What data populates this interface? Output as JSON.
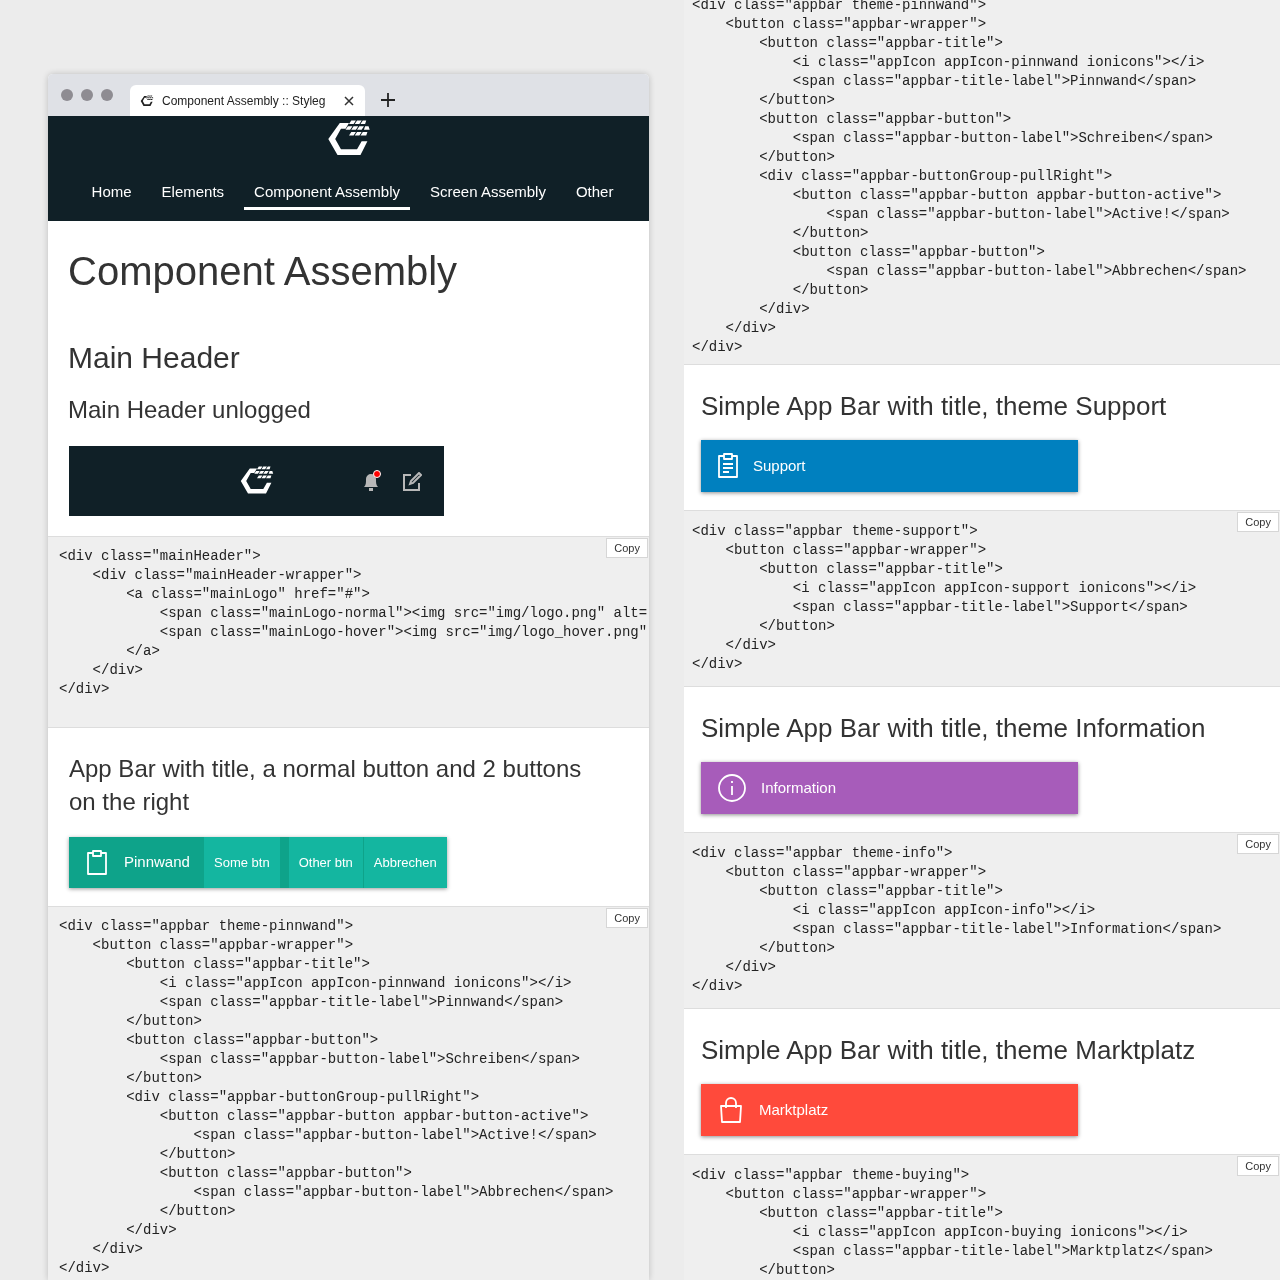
{
  "browser": {
    "tab_title": "Component Assembly :: Styleg",
    "nav": [
      {
        "label": "Home",
        "selected": false
      },
      {
        "label": "Elements",
        "selected": false
      },
      {
        "label": "Component Assembly",
        "selected": true
      },
      {
        "label": "Screen Assembly",
        "selected": false
      },
      {
        "label": "Other",
        "selected": false
      }
    ]
  },
  "page": {
    "title": "Component Assembly",
    "section": "Main Header",
    "subsection": "Main Header unlogged",
    "preview_header": {
      "notification": true
    },
    "main_header_code": {
      "copy": "Copy",
      "lines": [
        "<div class=\"mainHeader\">",
        "    <div class=\"mainHeader-wrapper\">",
        "        <a class=\"mainLogo\" href=\"#\">",
        "            <span class=\"mainLogo-normal\"><img src=\"img/logo.png\" alt=",
        "            <span class=\"mainLogo-hover\"><img src=\"img/logo_hover.png\"",
        "        </a>",
        "    </div>",
        "</div>"
      ]
    },
    "appbar_example": {
      "heading": "App Bar with title, a normal button and 2 buttons on the right",
      "bar": {
        "title": "Pinnwand",
        "kind": "clipboard",
        "color": "#0ea38a",
        "buttons": [
          "Some btn"
        ],
        "right_buttons": [
          "Other btn",
          "Abbrechen"
        ]
      },
      "code": {
        "copy": "Copy",
        "lines": [
          "<div class=\"appbar theme-pinnwand\">",
          "    <button class=\"appbar-wrapper\">",
          "        <button class=\"appbar-title\">",
          "            <i class=\"appIcon appIcon-pinnwand ionicons\"></i>",
          "            <span class=\"appbar-title-label\">Pinnwand</span>",
          "        </button>",
          "        <button class=\"appbar-button\">",
          "            <span class=\"appbar-button-label\">Schreiben</span>",
          "        </button>",
          "        <div class=\"appbar-buttonGroup-pullRight\">",
          "            <button class=\"appbar-button appbar-button-active\">",
          "                <span class=\"appbar-button-label\">Active!</span>",
          "            </button>",
          "            <button class=\"appbar-button\">",
          "                <span class=\"appbar-button-label\">Abbrechen</span>",
          "            </button>",
          "        </div>",
          "    </div>",
          "</div>"
        ]
      }
    }
  },
  "right_panel": {
    "top_code": {
      "lines": [
        "<div class=\"appbar theme-pinnwand\">",
        "    <button class=\"appbar-wrapper\">",
        "        <button class=\"appbar-title\">",
        "            <i class=\"appIcon appIcon-pinnwand ionicons\"></i>",
        "            <span class=\"appbar-title-label\">Pinnwand</span>",
        "        </button>",
        "        <button class=\"appbar-button\">",
        "            <span class=\"appbar-button-label\">Schreiben</span>",
        "        </button>",
        "        <div class=\"appbar-buttonGroup-pullRight\">",
        "            <button class=\"appbar-button appbar-button-active\">",
        "                <span class=\"appbar-button-label\">Active!</span>",
        "            </button>",
        "            <button class=\"appbar-button\">",
        "                <span class=\"appbar-button-label\">Abbrechen</span>",
        "            </button>",
        "        </div>",
        "    </div>",
        "</div>"
      ]
    },
    "examples": [
      {
        "heading": "Simple App Bar with title, theme Support",
        "title": "Support",
        "kind": "clipboard-list",
        "color": "#0080bf",
        "code": {
          "copy": "Copy",
          "lines": [
            "<div class=\"appbar theme-support\">",
            "    <button class=\"appbar-wrapper\">",
            "        <button class=\"appbar-title\">",
            "            <i class=\"appIcon appIcon-support ionicons\"></i>",
            "            <span class=\"appbar-title-label\">Support</span>",
            "        </button>",
            "    </div>",
            "</div>"
          ]
        }
      },
      {
        "heading": "Simple App Bar with title, theme Information",
        "title": "Information",
        "kind": "info",
        "color": "#a75cba",
        "code": {
          "copy": "Copy",
          "lines": [
            "<div class=\"appbar theme-info\">",
            "    <button class=\"appbar-wrapper\">",
            "        <button class=\"appbar-title\">",
            "            <i class=\"appIcon appIcon-info\"></i>",
            "            <span class=\"appbar-title-label\">Information</span>",
            "        </button>",
            "    </div>",
            "</div>"
          ]
        }
      },
      {
        "heading": "Simple App Bar with title, theme Marktplatz",
        "title": "Marktplatz",
        "kind": "bag",
        "color": "#ff4a3b",
        "code": {
          "copy": "Copy",
          "lines": [
            "<div class=\"appbar theme-buying\">",
            "    <button class=\"appbar-wrapper\">",
            "        <button class=\"appbar-title\">",
            "            <i class=\"appIcon appIcon-buying ionicons\"></i>",
            "            <span class=\"appbar-title-label\">Marktplatz</span>",
            "        </button>"
          ]
        }
      }
    ]
  }
}
